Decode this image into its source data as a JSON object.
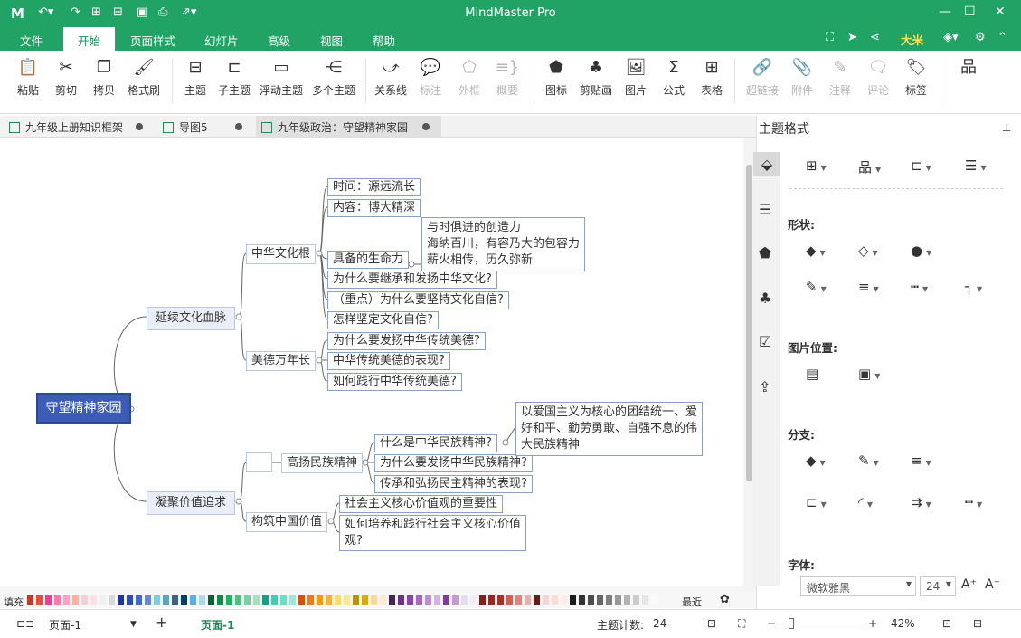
{
  "app": {
    "title": "MindMaster Pro",
    "logo": "M"
  },
  "quick_access": [
    "undo-icon",
    "redo-icon",
    "new-icon",
    "open-icon",
    "save-icon",
    "print-icon",
    "export-icon"
  ],
  "menu": {
    "items": [
      "文件",
      "开始",
      "页面样式",
      "幻灯片",
      "高级",
      "视图",
      "帮助"
    ],
    "active": "开始",
    "user": "大米"
  },
  "ribbon": {
    "buttons": [
      "粘贴",
      "剪切",
      "拷贝",
      "格式刷",
      "主题",
      "子主题",
      "浮动主题",
      "多个主题",
      "关系线",
      "标注",
      "外框",
      "概要",
      "图标",
      "剪贴画",
      "图片",
      "公式",
      "表格",
      "超链接",
      "附件",
      "注释",
      "评论",
      "标签"
    ]
  },
  "tabs": [
    {
      "label": "九年级上册知识框架"
    },
    {
      "label": "导图5"
    },
    {
      "label": "九年级政治：守望精神家园"
    }
  ],
  "map": {
    "root": "守望精神家园",
    "b1": "延续文化血脉",
    "b2": "凝聚价值追求",
    "c1": "中华文化根",
    "c2": "美德万年长",
    "c3": "高扬民族精神",
    "c4": "构筑中国价值",
    "d1": "时间：源远流长",
    "d2": "内容：博大精深",
    "d3": "具备的生命力",
    "d3n": [
      "与时俱进的创造力",
      "海纳百川，有容乃大的包容力",
      "薪火相传，历久弥新"
    ],
    "d4": "为什么要继承和发扬中华文化?",
    "d5": "（重点）为什么要坚持文化自信?",
    "d6": "怎样坚定文化自信?",
    "e1": "为什么要发扬中华传统美德?",
    "e2": "中华传统美德的表现?",
    "e3": "如何践行中华传统美德?",
    "f1": "什么是中华民族精神?",
    "f2": "为什么要发扬中华民族精神?",
    "f3": "传承和弘扬民主精神的表现?",
    "f1n": [
      "以爱国主义为核心的团结统一、爱",
      "好和平、勤劳勇敢、自强不息的伟",
      "大民族精神"
    ],
    "g1": "社会主义核心价值观的重要性",
    "g2": [
      "如何培养和践行社会主义核心价值",
      "观?"
    ]
  },
  "panel": {
    "title": "主题格式",
    "shape": "形状:",
    "image_pos": "图片位置:",
    "branch": "分支:",
    "font": "字体:",
    "font_name": "微软雅黑",
    "font_size": "24"
  },
  "palette": {
    "label": "填充",
    "recent": "最近"
  },
  "status": {
    "page_select": "页面-1",
    "page_tab": "页面-1",
    "count_label": "主题计数:",
    "count": "24",
    "zoom": "42%"
  }
}
